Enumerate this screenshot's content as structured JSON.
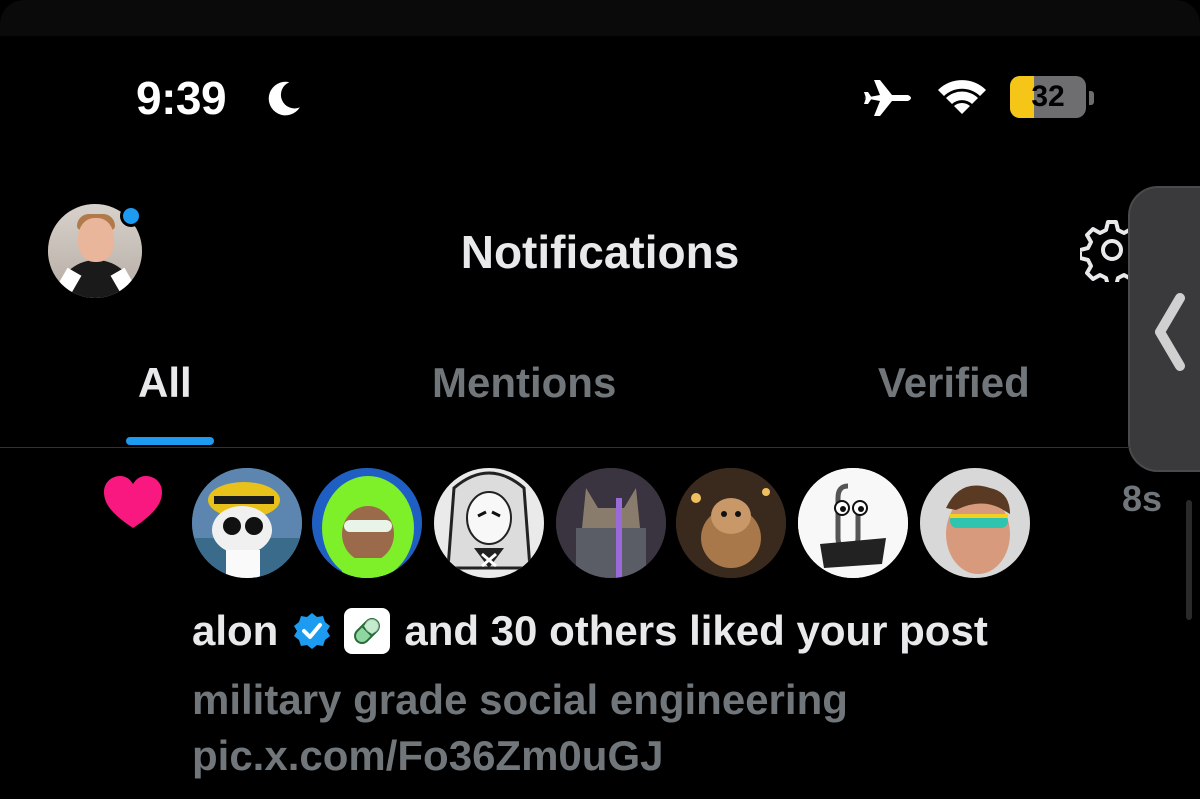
{
  "status_bar": {
    "time": "9:39",
    "battery_level": "32",
    "battery_fraction": 0.32,
    "icons": [
      "moon-icon",
      "airplane-icon",
      "wifi-icon",
      "battery-icon"
    ]
  },
  "header": {
    "title": "Notifications",
    "avatar": "profile-avatar",
    "settings_icon": "gear-icon"
  },
  "tabs": [
    {
      "label": "All",
      "active": true
    },
    {
      "label": "Mentions",
      "active": false
    },
    {
      "label": "Verified",
      "active": false
    }
  ],
  "notification": {
    "type_icon": "heart-icon",
    "timestamp": "8s",
    "user": "alon",
    "message": "and 30 others liked your post",
    "post_text": "military grade social engineering pic.x.com/Fo36Zm0uGJ",
    "likers": [
      "liker-avatar-1",
      "liker-avatar-2",
      "liker-avatar-3",
      "liker-avatar-4",
      "liker-avatar-5",
      "liker-avatar-6",
      "liker-avatar-7"
    ]
  },
  "colors": {
    "accent": "#1d9bf0",
    "heart": "#f91880",
    "muted": "#71767b",
    "text": "#e7e9ea",
    "battery": "#f5c518"
  }
}
